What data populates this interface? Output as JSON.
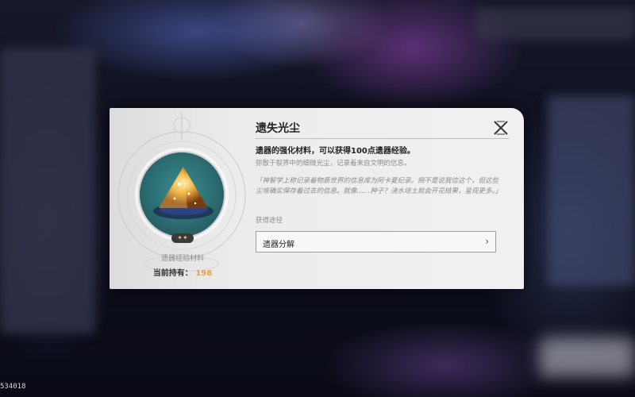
{
  "item": {
    "name": "遗失光尘",
    "effect": "遗器的强化材料，可以获得100点遗器经验。",
    "description": "弥散于裂界中的细微光尘，记录着来自文明的信息。",
    "lore": "「神智学上称记录着物质世界的信息库为阿卡夏纪录。倒不是说我信这个，但这些尘埃确实保存着过去的信息。就像……种子？浇水培土就会开花结果，呈现更多。」",
    "type_label": "遗器经验材料",
    "owned_label": "当前持有：",
    "owned_count": "198",
    "rarity_stars": "✦✦"
  },
  "source": {
    "label": "获得途径",
    "button_label": "遗器分解",
    "chevron": "›"
  },
  "footer": {
    "uid": "534018"
  },
  "icons": [
    "close-icon",
    "item-icon",
    "chevron-right-icon",
    "star-icon"
  ],
  "colors": {
    "accent_count": "#e8a24a",
    "item_circle": "#2b6b70"
  }
}
